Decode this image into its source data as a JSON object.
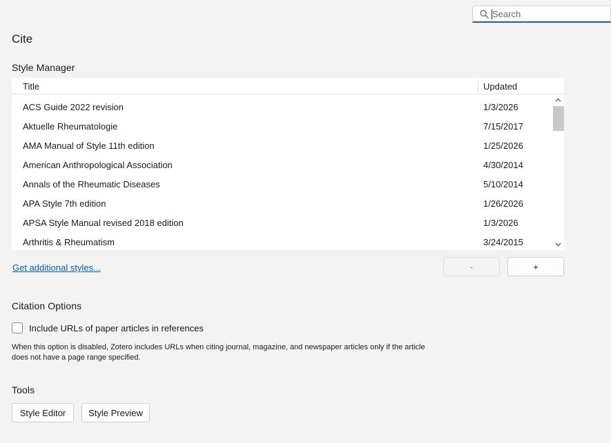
{
  "search": {
    "placeholder": "Search",
    "value": "",
    "icon": "search-icon"
  },
  "pane": {
    "title": "Cite"
  },
  "style_manager": {
    "heading": "Style Manager",
    "columns": {
      "title": "Title",
      "updated": "Updated"
    },
    "rows": [
      {
        "title": "ACS Guide 2022 revision",
        "updated": "1/3/2026"
      },
      {
        "title": "Aktuelle Rheumatologie",
        "updated": "7/15/2017"
      },
      {
        "title": "AMA Manual of Style 11th edition",
        "updated": "1/25/2026"
      },
      {
        "title": "American Anthropological Association",
        "updated": "4/30/2014"
      },
      {
        "title": "Annals of the Rheumatic Diseases",
        "updated": "5/10/2014"
      },
      {
        "title": "APA Style 7th edition",
        "updated": "1/26/2026"
      },
      {
        "title": "APSA Style Manual revised 2018 edition",
        "updated": "1/3/2026"
      },
      {
        "title": "Arthritis & Rheumatism",
        "updated": "3/24/2015"
      }
    ],
    "get_more_link": "Get additional styles...",
    "remove_label": "-",
    "add_label": "+"
  },
  "citation_options": {
    "heading": "Citation Options",
    "include_urls_label": "Include URLs of paper articles in references",
    "include_urls_checked": false,
    "description": "When this option is disabled, Zotero includes URLs when citing journal, magazine, and newspaper articles only if the article does not have a page range specified."
  },
  "tools": {
    "heading": "Tools",
    "style_editor_label": "Style Editor",
    "style_preview_label": "Style Preview"
  },
  "colors": {
    "background": "#f3f3f3",
    "accent": "#1a5fb4",
    "link": "#0b5cad"
  }
}
